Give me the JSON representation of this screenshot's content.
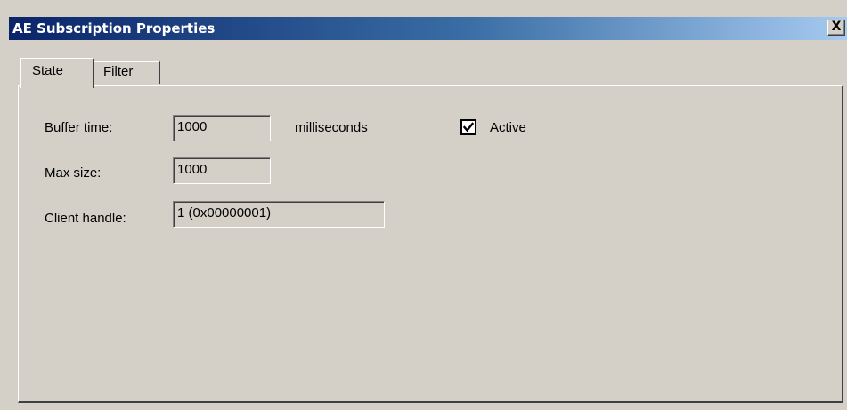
{
  "window": {
    "title": "AE Subscription Properties",
    "close_glyph": "X"
  },
  "tabs": [
    {
      "label": "State",
      "active": true
    },
    {
      "label": "Filter",
      "active": false
    }
  ],
  "form": {
    "buffer_time": {
      "label": "Buffer time:",
      "value": "1000",
      "unit": "milliseconds"
    },
    "max_size": {
      "label": "Max size:",
      "value": "1000"
    },
    "client_handle": {
      "label": "Client handle:",
      "value": "1 (0x00000001)"
    },
    "active": {
      "label": "Active",
      "checked": true
    }
  },
  "colors": {
    "title_bar_start": "#0a246a",
    "title_bar_end": "#a6caf0",
    "face": "#d4d0c8"
  },
  "icons": {
    "close": "close-icon",
    "check": "checkmark-icon"
  }
}
